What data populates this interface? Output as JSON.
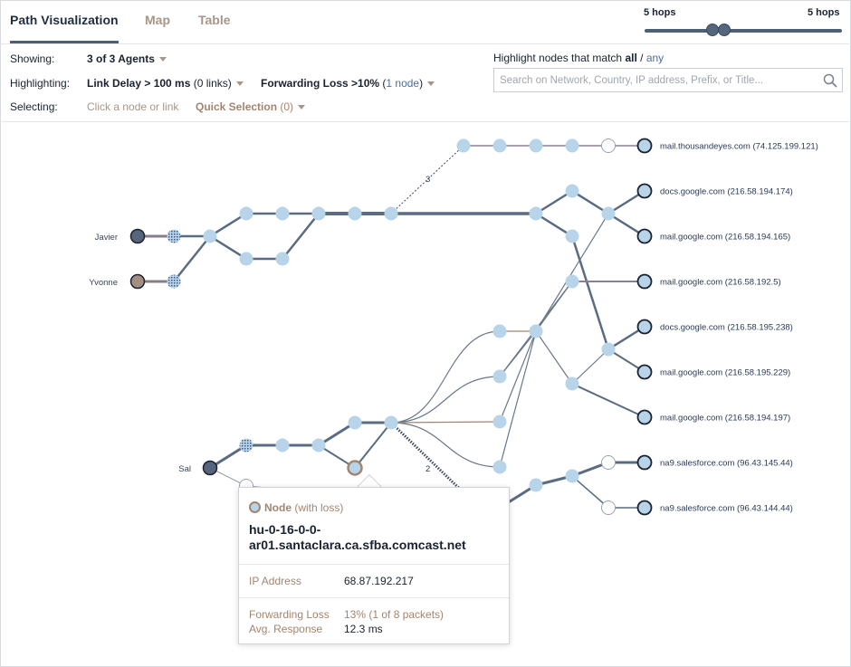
{
  "tabs": [
    {
      "label": "Path Visualization",
      "active": true
    },
    {
      "label": "Map",
      "active": false
    },
    {
      "label": "Table",
      "active": false
    }
  ],
  "hops": {
    "left_label": "5 hops",
    "right_label": "5 hops"
  },
  "controls": {
    "showing_label": "Showing:",
    "showing_value": "3 of 3 Agents",
    "highlighting_label": "Highlighting:",
    "link_delay_label": "Link Delay > 100 ms",
    "link_delay_count": "(0 links)",
    "fwd_loss_label": "Forwarding Loss >10%",
    "fwd_loss_count_open": "(",
    "fwd_loss_count": "1 node",
    "fwd_loss_count_close": ")",
    "selecting_label": "Selecting:",
    "selecting_hint": "Click a node or link",
    "quick_selection": "Quick Selection",
    "quick_selection_count": "(0)"
  },
  "highlight": {
    "prefix": "Highlight nodes that match",
    "all": "all",
    "sep": "/",
    "any": "any",
    "search_placeholder": "Search on Network, Country, IP address, Prefix, or Title..."
  },
  "agents": [
    {
      "name": "Javier"
    },
    {
      "name": "Yvonne"
    },
    {
      "name": "Sal"
    }
  ],
  "destinations": [
    {
      "label": "mail.thousandeyes.com (74.125.199.121)"
    },
    {
      "label": "docs.google.com (216.58.194.174)"
    },
    {
      "label": "mail.google.com (216.58.194.165)"
    },
    {
      "label": "mail.google.com (216.58.192.5)"
    },
    {
      "label": "docs.google.com (216.58.195.238)"
    },
    {
      "label": "mail.google.com (216.58.195.229)"
    },
    {
      "label": "mail.google.com (216.58.194.197)"
    },
    {
      "label": "na9.salesforce.com (96.43.145.44)"
    },
    {
      "label": "na9.salesforce.com (96.43.144.44)"
    }
  ],
  "link_labels": {
    "hidden_top": "3",
    "hidden_bottom": "2"
  },
  "popup": {
    "type": "Node",
    "type_note": "(with loss)",
    "name": "hu-0-16-0-0-ar01.santaclara.ca.sfba.comcast.net",
    "ip_label": "IP Address",
    "ip": "68.87.192.217",
    "loss_label": "Forwarding Loss",
    "loss": "13% (1 of 8 packets)",
    "resp_label": "Avg. Response",
    "resp": "12.3 ms"
  },
  "colors": {
    "node_fill": "#b8d4e8",
    "link": "#5a6c82",
    "loss": "#a28570",
    "agent_dark": "#56657c",
    "accent": "#4a5e78"
  }
}
